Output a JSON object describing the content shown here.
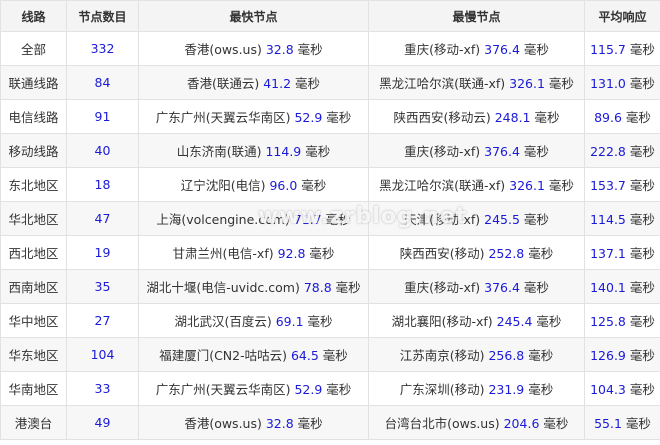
{
  "headers": [
    "线路",
    "节点数目",
    "最快节点",
    "最慢节点",
    "平均响应"
  ],
  "unit": "毫秒",
  "rows": [
    {
      "route": "全部",
      "count": "332",
      "fast_name": "香港(ows.us)",
      "fast_ms": "32.8",
      "slow_name": "重庆(移动-xf)",
      "slow_ms": "376.4",
      "avg_ms": "115.7"
    },
    {
      "route": "联通线路",
      "count": "84",
      "fast_name": "香港(联通云)",
      "fast_ms": "41.2",
      "slow_name": "黑龙江哈尔滨(联通-xf)",
      "slow_ms": "326.1",
      "avg_ms": "131.0"
    },
    {
      "route": "电信线路",
      "count": "91",
      "fast_name": "广东广州(天翼云华南区)",
      "fast_ms": "52.9",
      "slow_name": "陕西西安(移动云)",
      "slow_ms": "248.1",
      "avg_ms": "89.6"
    },
    {
      "route": "移动线路",
      "count": "40",
      "fast_name": "山东济南(联通)",
      "fast_ms": "114.9",
      "slow_name": "重庆(移动-xf)",
      "slow_ms": "376.4",
      "avg_ms": "222.8"
    },
    {
      "route": "东北地区",
      "count": "18",
      "fast_name": "辽宁沈阳(电信)",
      "fast_ms": "96.0",
      "slow_name": "黑龙江哈尔滨(联通-xf)",
      "slow_ms": "326.1",
      "avg_ms": "153.7"
    },
    {
      "route": "华北地区",
      "count": "47",
      "fast_name": "上海(volcengine.com)",
      "fast_ms": "71.7",
      "slow_name": "天津(移动-xf)",
      "slow_ms": "245.5",
      "avg_ms": "114.5"
    },
    {
      "route": "西北地区",
      "count": "19",
      "fast_name": "甘肃兰州(电信-xf)",
      "fast_ms": "92.8",
      "slow_name": "陕西西安(移动)",
      "slow_ms": "252.8",
      "avg_ms": "137.1"
    },
    {
      "route": "西南地区",
      "count": "35",
      "fast_name": "湖北十堰(电信-uvidc.com)",
      "fast_ms": "78.8",
      "slow_name": "重庆(移动-xf)",
      "slow_ms": "376.4",
      "avg_ms": "140.1"
    },
    {
      "route": "华中地区",
      "count": "27",
      "fast_name": "湖北武汉(百度云)",
      "fast_ms": "69.1",
      "slow_name": "湖北襄阳(移动-xf)",
      "slow_ms": "245.4",
      "avg_ms": "125.8"
    },
    {
      "route": "华东地区",
      "count": "104",
      "fast_name": "福建厦门(CN2-咕咕云)",
      "fast_ms": "64.5",
      "slow_name": "江苏南京(移动)",
      "slow_ms": "256.8",
      "avg_ms": "126.9"
    },
    {
      "route": "华南地区",
      "count": "33",
      "fast_name": "广东广州(天翼云华南区)",
      "fast_ms": "52.9",
      "slow_name": "广东深圳(移动)",
      "slow_ms": "231.9",
      "avg_ms": "104.3"
    },
    {
      "route": "港澳台",
      "count": "49",
      "fast_name": "香港(ows.us)",
      "fast_ms": "32.8",
      "slow_name": "台湾台北市(ows.us)",
      "slow_ms": "204.6",
      "avg_ms": "55.1"
    }
  ],
  "watermark": "www.zrblog.net"
}
